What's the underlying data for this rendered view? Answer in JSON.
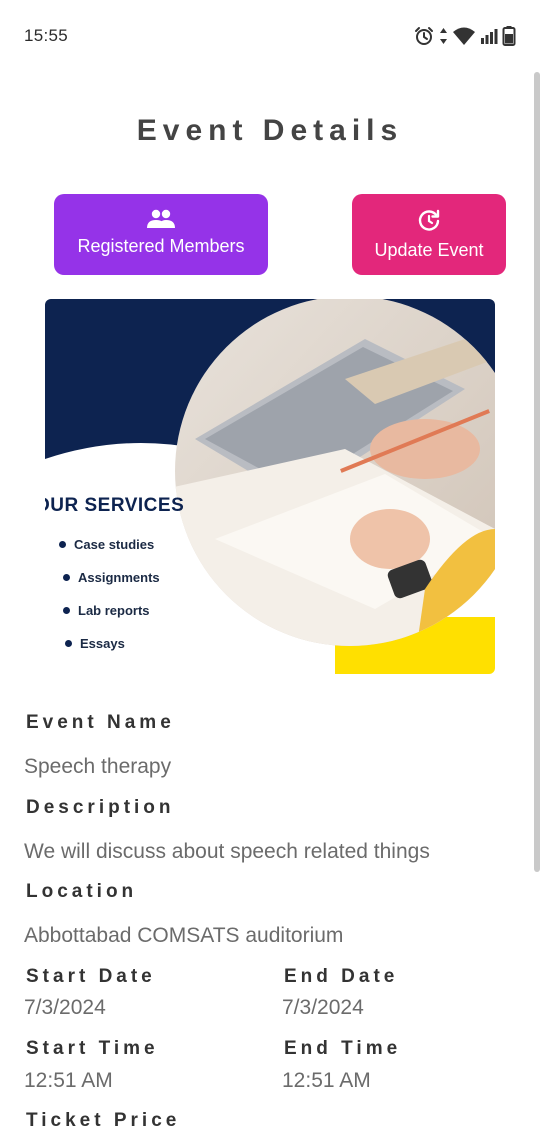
{
  "status_bar": {
    "time": "15:55"
  },
  "page": {
    "title": "Event Details"
  },
  "buttons": {
    "registered_members": "Registered Members",
    "update_event": "Update Event"
  },
  "banner": {
    "heading": "OUR SERVICES",
    "items": [
      "Case studies",
      "Assignments",
      "Lab reports",
      "Essays"
    ],
    "colors": {
      "navy": "#0d2350",
      "yellow": "#ffe000"
    }
  },
  "event": {
    "name_label": "Event Name",
    "name": "Speech therapy",
    "description_label": "Description",
    "description": "We will discuss about speech related things",
    "location_label": "Location",
    "location": "Abbottabad COMSATS auditorium",
    "start_date_label": "Start Date",
    "start_date": "7/3/2024",
    "end_date_label": "End Date",
    "end_date": "7/3/2024",
    "start_time_label": "Start Time",
    "start_time": "12:51 AM",
    "end_time_label": "End Time",
    "end_time": "12:51 AM",
    "ticket_price_label": "Ticket Price"
  },
  "colors": {
    "purple_button": "#9533e8",
    "pink_button": "#e3277b"
  },
  "icons": [
    "alarm-icon",
    "data-arrows-icon",
    "wifi-icon",
    "signal-icon",
    "battery-icon",
    "group-icon",
    "refresh-icon"
  ]
}
